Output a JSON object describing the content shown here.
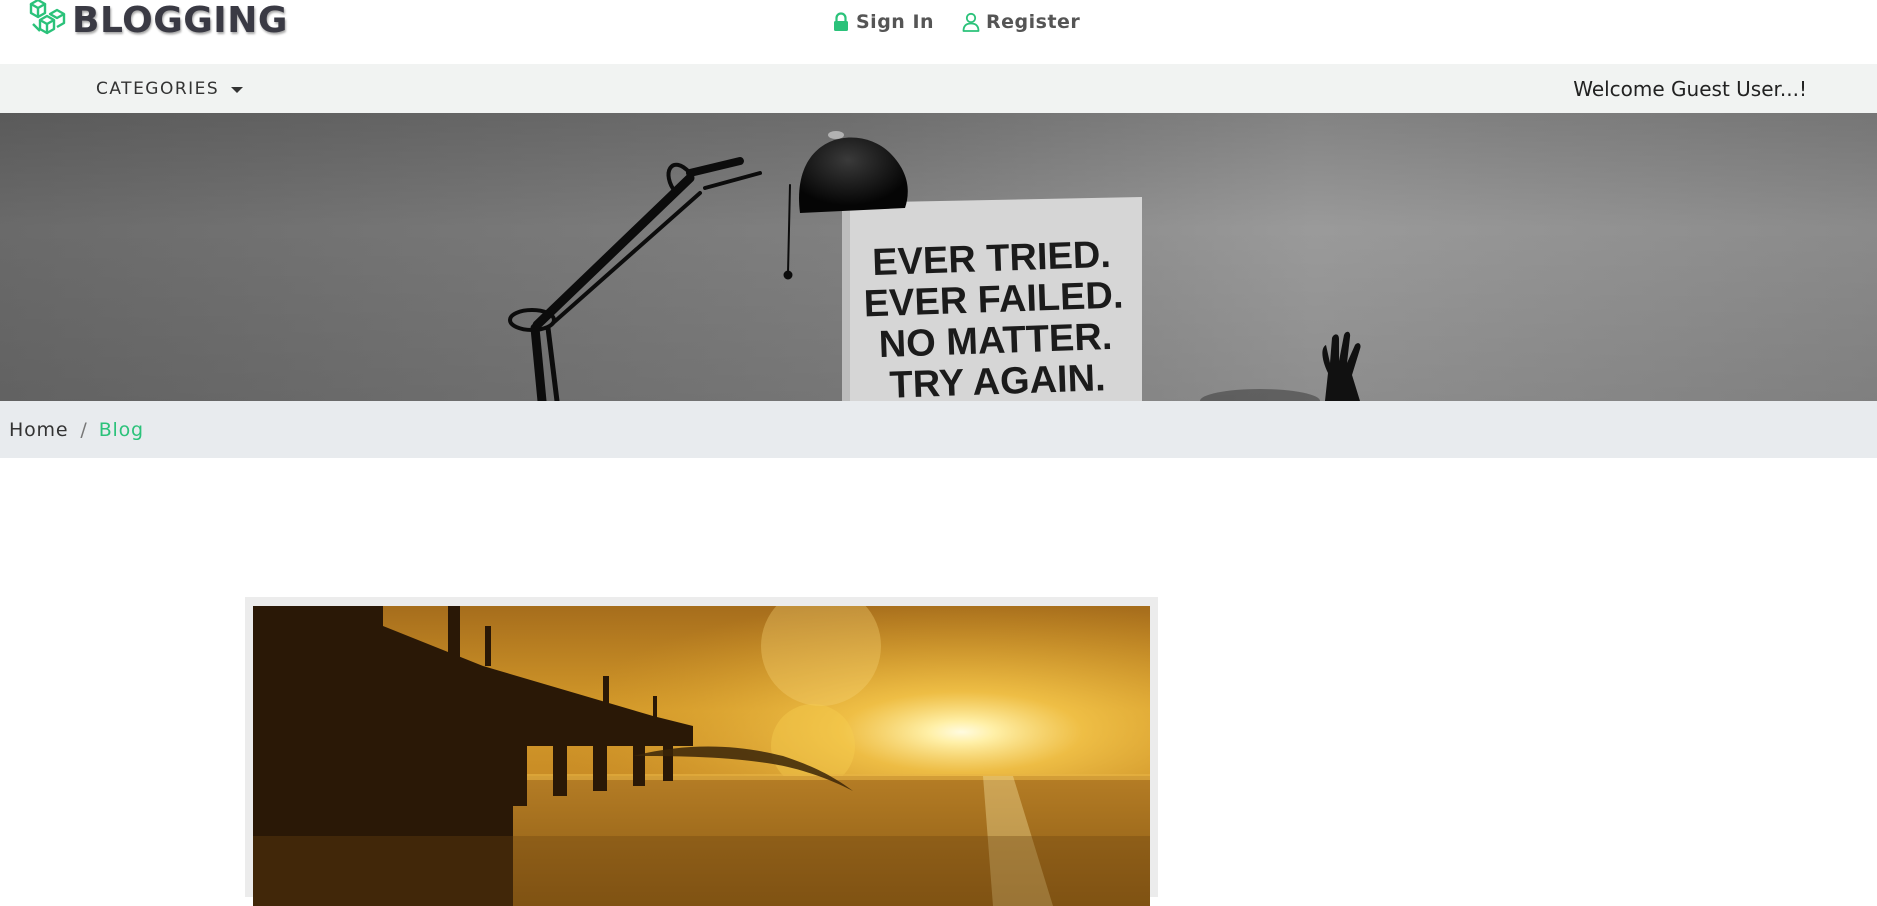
{
  "header": {
    "brand": "BLOGGING",
    "logo_icon": "cubes-logo-icon",
    "brand_color": "#2bc27a",
    "auth": {
      "signin_label": "Sign In",
      "signin_icon": "lock-icon",
      "register_label": "Register",
      "register_icon": "user-icon"
    }
  },
  "navbar": {
    "categories_label": "CATEGORIES",
    "welcome_text": "Welcome Guest User...!"
  },
  "hero": {
    "sign_lines": [
      "EVER TRIED.",
      "EVER FAILED.",
      "NO MATTER.",
      "TRY AGAIN."
    ]
  },
  "breadcrumb": {
    "items": [
      "Home",
      "Blog"
    ],
    "separator": "/",
    "active_color": "#2bc27a"
  }
}
